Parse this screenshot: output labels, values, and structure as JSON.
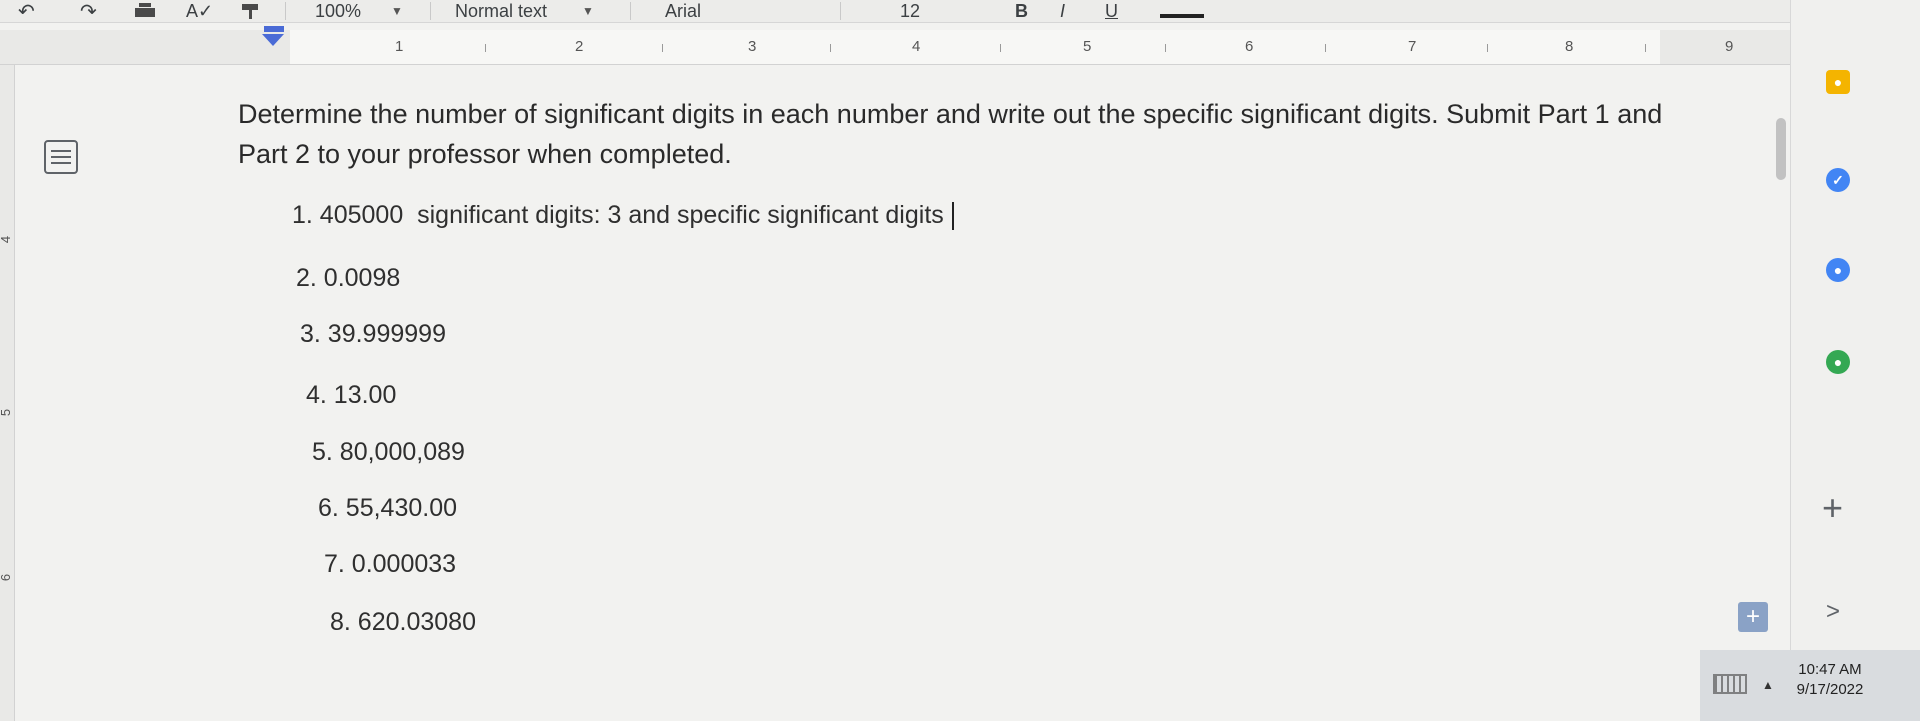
{
  "toolbar": {
    "zoom": "100%",
    "style": "Normal text",
    "font": "Arial",
    "font_size": "12"
  },
  "ruler": {
    "numbers": [
      "1",
      "2",
      "3",
      "4",
      "5",
      "6",
      "7",
      "8",
      "9"
    ]
  },
  "left_ruler": {
    "numbers": [
      "4",
      "5",
      "6"
    ]
  },
  "document": {
    "instructions": "Determine the number of significant digits in each number and write out the specific significant digits. Submit Part 1 and Part 2 to your professor when completed.",
    "items": [
      "1. 405000  significant digits: 3 and specific significant digits",
      "2. 0.0098",
      "3. 39.999999",
      "4. 13.00",
      "5. 80,000,089",
      "6. 55,430.00",
      "7. 0.000033",
      "8. 620.03080"
    ]
  },
  "taskbar": {
    "time": "10:47 AM",
    "date": "9/17/2022"
  },
  "colors": {
    "accent": "#4a6bd6",
    "keep": "#f4b400",
    "tasks": "#4285f4",
    "maps": "#34a853"
  }
}
